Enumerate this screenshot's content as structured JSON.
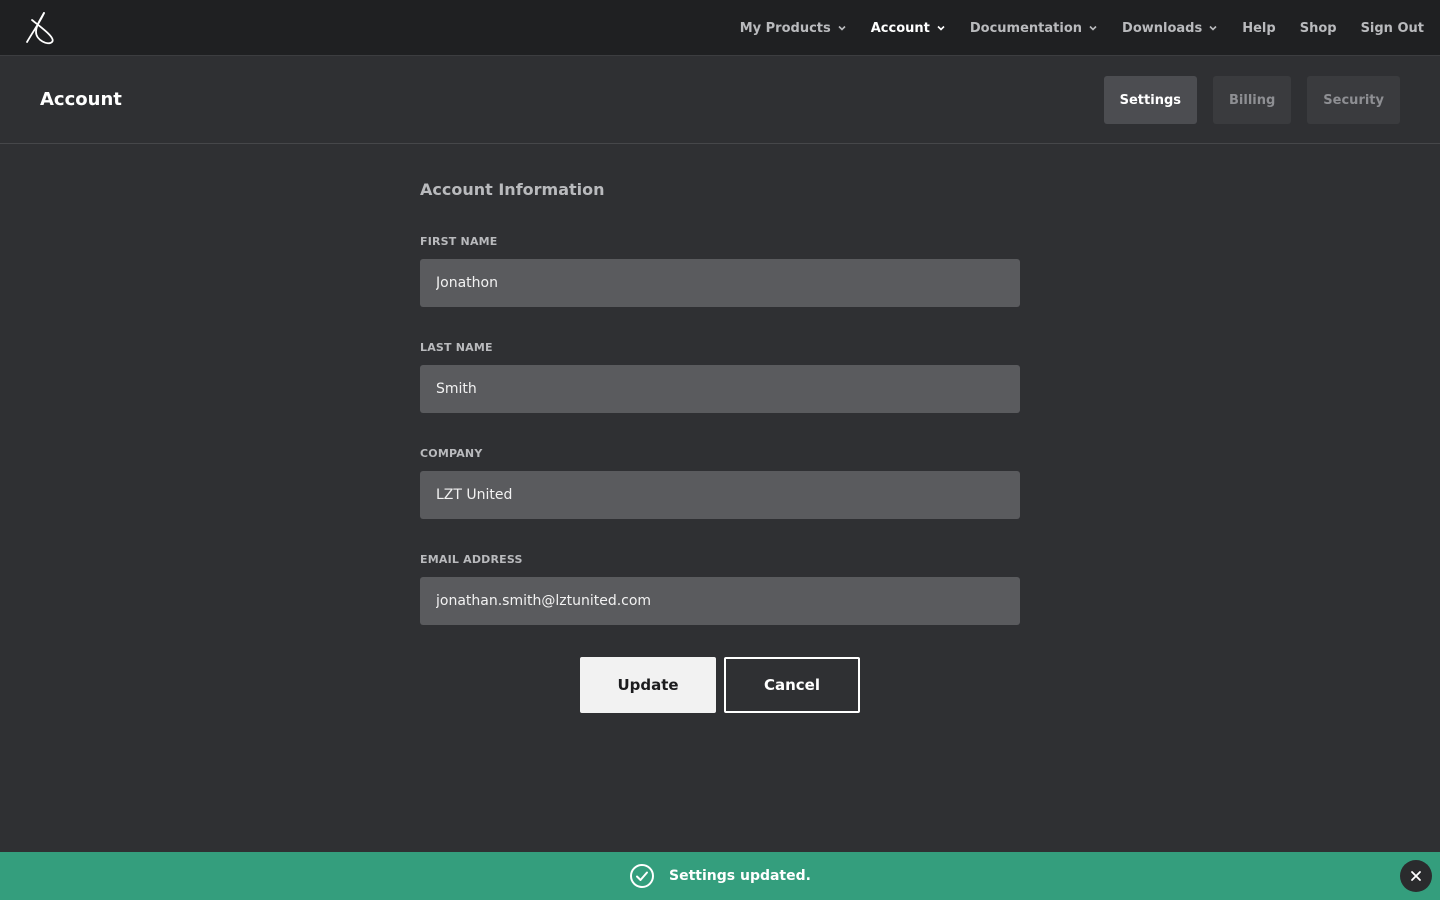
{
  "nav": {
    "items": [
      {
        "label": "My Products",
        "dropdown": true,
        "active": false
      },
      {
        "label": "Account",
        "dropdown": true,
        "active": true
      },
      {
        "label": "Documentation",
        "dropdown": true,
        "active": false
      },
      {
        "label": "Downloads",
        "dropdown": true,
        "active": false
      },
      {
        "label": "Help",
        "dropdown": false,
        "active": false
      },
      {
        "label": "Shop",
        "dropdown": false,
        "active": false
      },
      {
        "label": "Sign Out",
        "dropdown": false,
        "active": false
      }
    ]
  },
  "header": {
    "title": "Account",
    "tabs": [
      {
        "label": "Settings",
        "active": true
      },
      {
        "label": "Billing",
        "active": false
      },
      {
        "label": "Security",
        "active": false
      }
    ]
  },
  "form": {
    "section_title": "Account Information",
    "fields": {
      "first_name": {
        "label": "FIRST NAME",
        "value": "Jonathon"
      },
      "last_name": {
        "label": "LAST NAME",
        "value": "Smith"
      },
      "company": {
        "label": "COMPANY",
        "value": "LZT United"
      },
      "email": {
        "label": "EMAIL ADDRESS",
        "value": "jonathan.smith@lztunited.com"
      }
    },
    "update_label": "Update",
    "cancel_label": "Cancel"
  },
  "toast": {
    "message": "Settings updated.",
    "icon": "check-circle-icon",
    "color": "#349e7d"
  },
  "colors": {
    "background": "#2f3033",
    "topnav": "#1f2022",
    "input": "#5a5b5e",
    "success": "#349e7d"
  }
}
